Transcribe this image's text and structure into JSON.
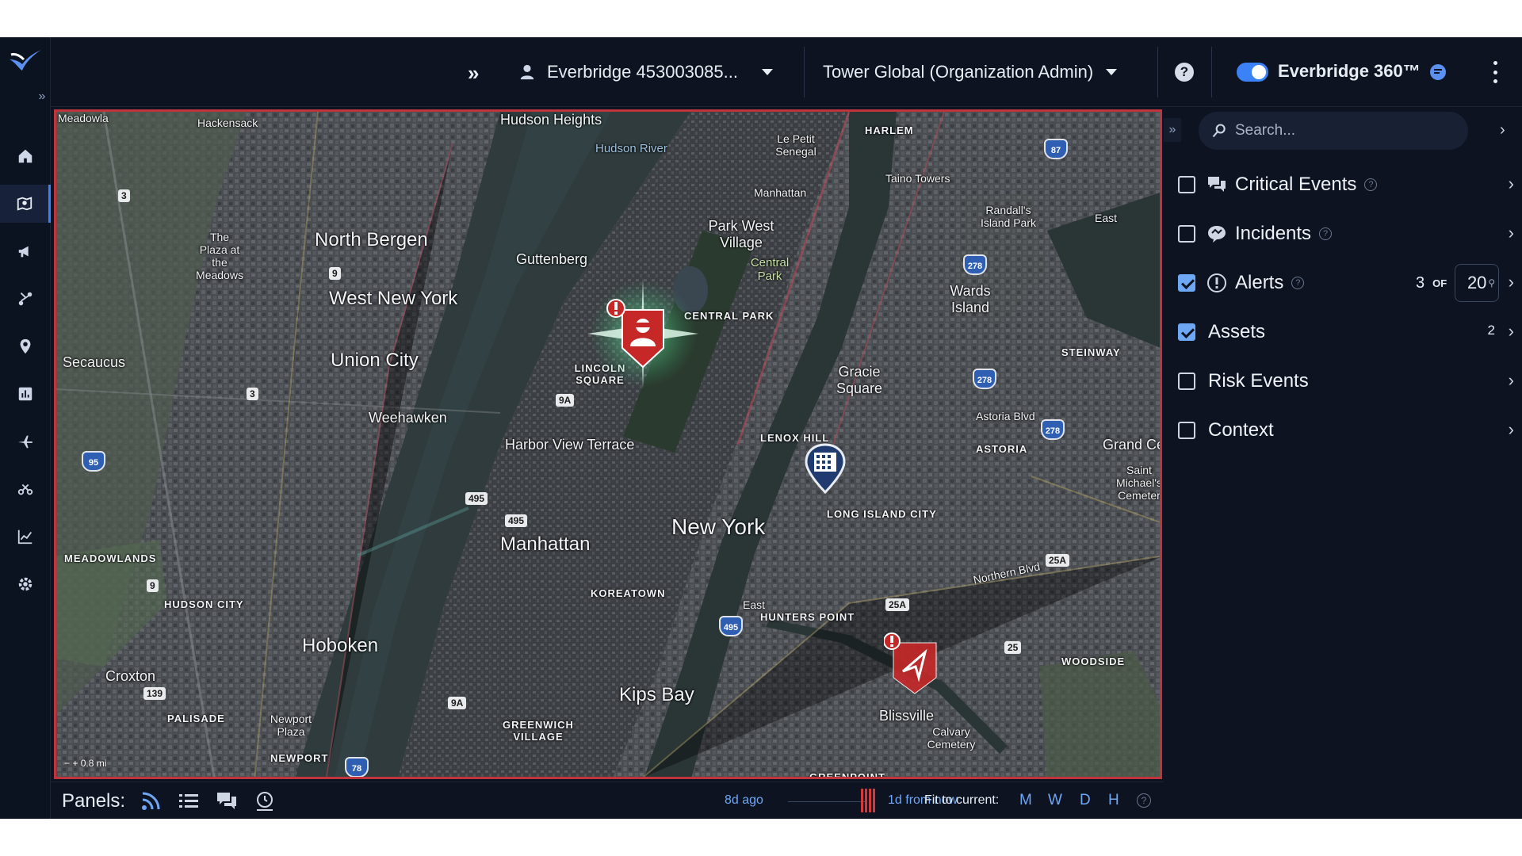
{
  "header": {
    "expand_label": "»",
    "account": "Everbridge 453003085...",
    "organization": "Tower Global (Organization Admin)",
    "product": "Everbridge 360™",
    "toggle_on": true
  },
  "rail": {
    "items": [
      {
        "icon": "home-icon"
      },
      {
        "icon": "map-icon",
        "active": true
      },
      {
        "icon": "megaphone-icon"
      },
      {
        "icon": "workflow-icon"
      },
      {
        "icon": "location-pin-icon"
      },
      {
        "icon": "bar-chart-icon"
      },
      {
        "icon": "plane-icon"
      },
      {
        "icon": "scissors-icon"
      },
      {
        "icon": "line-chart-icon"
      },
      {
        "icon": "gear-icon"
      }
    ]
  },
  "map": {
    "labels": {
      "hudson_heights": "Hudson Heights",
      "hudson_river": "Hudson River",
      "hackensack": "Hackensack",
      "meadowlands_top": "Meadowla",
      "harlem": "HARLEM",
      "le_petit": "Le Petit Senegal",
      "manhattanville": "Manhattan",
      "taino": "Taino Towers",
      "randalls": "Randall's Island Park",
      "east": "East",
      "north_bergen": "North Bergen",
      "guttenberg": "Guttenberg",
      "park_west": "Park West Village",
      "central_park_lbl": "Central Park",
      "central_park_caps": "CENTRAL PARK",
      "wards": "Wards Island",
      "the_plaza": "The Plaza at the Meadows",
      "west_new_york": "West New York",
      "secaucus": "Secaucus",
      "union_city": "Union City",
      "lincoln": "LINCOLN SQUARE",
      "gracie": "Gracie Square",
      "steinway": "STEINWAY",
      "weehawken": "Weehawken",
      "harbor_view": "Harbor View Terrace",
      "lenox_hill": "LENOX HILL",
      "astoria": "ASTORIA",
      "astoria_blvd": "Astoria Blvd",
      "grand_central": "Grand Cen",
      "saint_michaels": "Saint Michael's Cemeter",
      "new_york": "New York",
      "manhattan": "Manhattan",
      "lic": "LONG ISLAND CITY",
      "meadowlands": "MEADOWLANDS",
      "hudson_city": "HUDSON CITY",
      "koreatown": "KOREATOWN",
      "hunters_point": "HUNTERS POINT",
      "hoboken": "Hoboken",
      "woodside": "WOODSIDE",
      "croxton": "Croxton",
      "kips_bay": "Kips Bay",
      "palisade": "PALISADE",
      "newport_plaza": "Newport Plaza",
      "greenwich": "GREENWICH VILLAGE",
      "blissville": "Blissville",
      "calvary": "Calvary Cemetery",
      "newport": "NEWPORT",
      "greenpoint": "GREENPOINT",
      "northern_blvd": "Northern Blvd",
      "east_river": "East",
      "scale": "0.8 mi"
    },
    "shields": [
      "3",
      "9",
      "3",
      "9A",
      "495",
      "495",
      "9A",
      "139",
      "9",
      "25A",
      "25A",
      "25"
    ],
    "interstates": [
      "87",
      "278",
      "278",
      "278",
      "95",
      "495",
      "78"
    ],
    "markers": [
      {
        "type": "alert",
        "icon": "person-alert-marker-icon",
        "color": "#c62828"
      },
      {
        "type": "asset",
        "icon": "building-marker-icon",
        "color": "#1f3b70"
      },
      {
        "type": "alert",
        "icon": "navigation-alert-marker-icon",
        "color": "#c62828"
      }
    ]
  },
  "search": {
    "placeholder": "Search..."
  },
  "layers": [
    {
      "name": "Critical Events",
      "checked": false,
      "icon": "critical-events-icon",
      "help": "?"
    },
    {
      "name": "Incidents",
      "checked": false,
      "icon": "incidents-icon",
      "help": "?"
    },
    {
      "name": "Alerts",
      "checked": true,
      "icon": "alert-exclamation-icon",
      "help": "?",
      "count": "3",
      "of": "OF",
      "total": "20"
    },
    {
      "name": "Assets",
      "checked": true,
      "count": "2"
    },
    {
      "name": "Risk Events",
      "checked": false
    },
    {
      "name": "Context",
      "checked": false
    }
  ],
  "bottom": {
    "panels_label": "Panels:",
    "timeline_start": "8d ago",
    "timeline_end": "1d from now",
    "fit_label": "Fit to current:",
    "fit_options": [
      "M",
      "W",
      "D",
      "H"
    ],
    "help": "?"
  },
  "colors": {
    "accent": "#3b82f6",
    "alert_red": "#c62828",
    "map_border": "#c0343c",
    "link_blue": "#6ea8f5"
  }
}
